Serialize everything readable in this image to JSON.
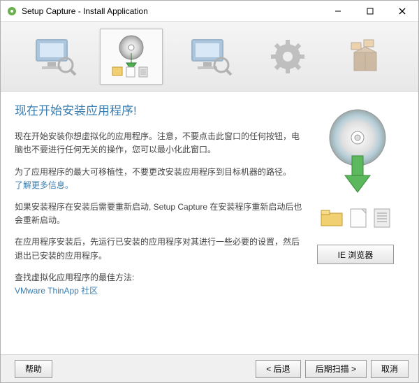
{
  "window": {
    "title": "Setup Capture - Install Application"
  },
  "steps": [
    {
      "name": "monitor-scan-icon"
    },
    {
      "name": "install-disc-icon",
      "active": true
    },
    {
      "name": "monitor-rescan-icon"
    },
    {
      "name": "gear-settings-icon"
    },
    {
      "name": "package-box-icon"
    }
  ],
  "content": {
    "heading": "现在开始安装应用程序!",
    "p1": "现在开始安装你想虚拟化的应用程序。注意，不要点击此窗口的任何按钮，电脑也不要进行任何无关的操作，您可以最小化此窗口。",
    "p2": "为了应用程序的最大可移植性，不要更改安装应用程序到目标机器的路径。",
    "link_more": "了解更多信息。",
    "p3": "如果安装程序在安装后需要重新启动, Setup Capture 在安装程序重新启动后也会重新启动。",
    "p4": "在应用程序安装后，先运行已安装的应用程序对其进行一些必要的设置，然后退出已安装的应用程序。",
    "p5": "查找虚拟化应用程序的最佳方法:",
    "link_community": "VMware ThinApp 社区"
  },
  "buttons": {
    "ie": "IE 浏览器",
    "help": "帮助",
    "back": "< 后退",
    "postscan": "后期扫描 >",
    "cancel": "取消"
  }
}
